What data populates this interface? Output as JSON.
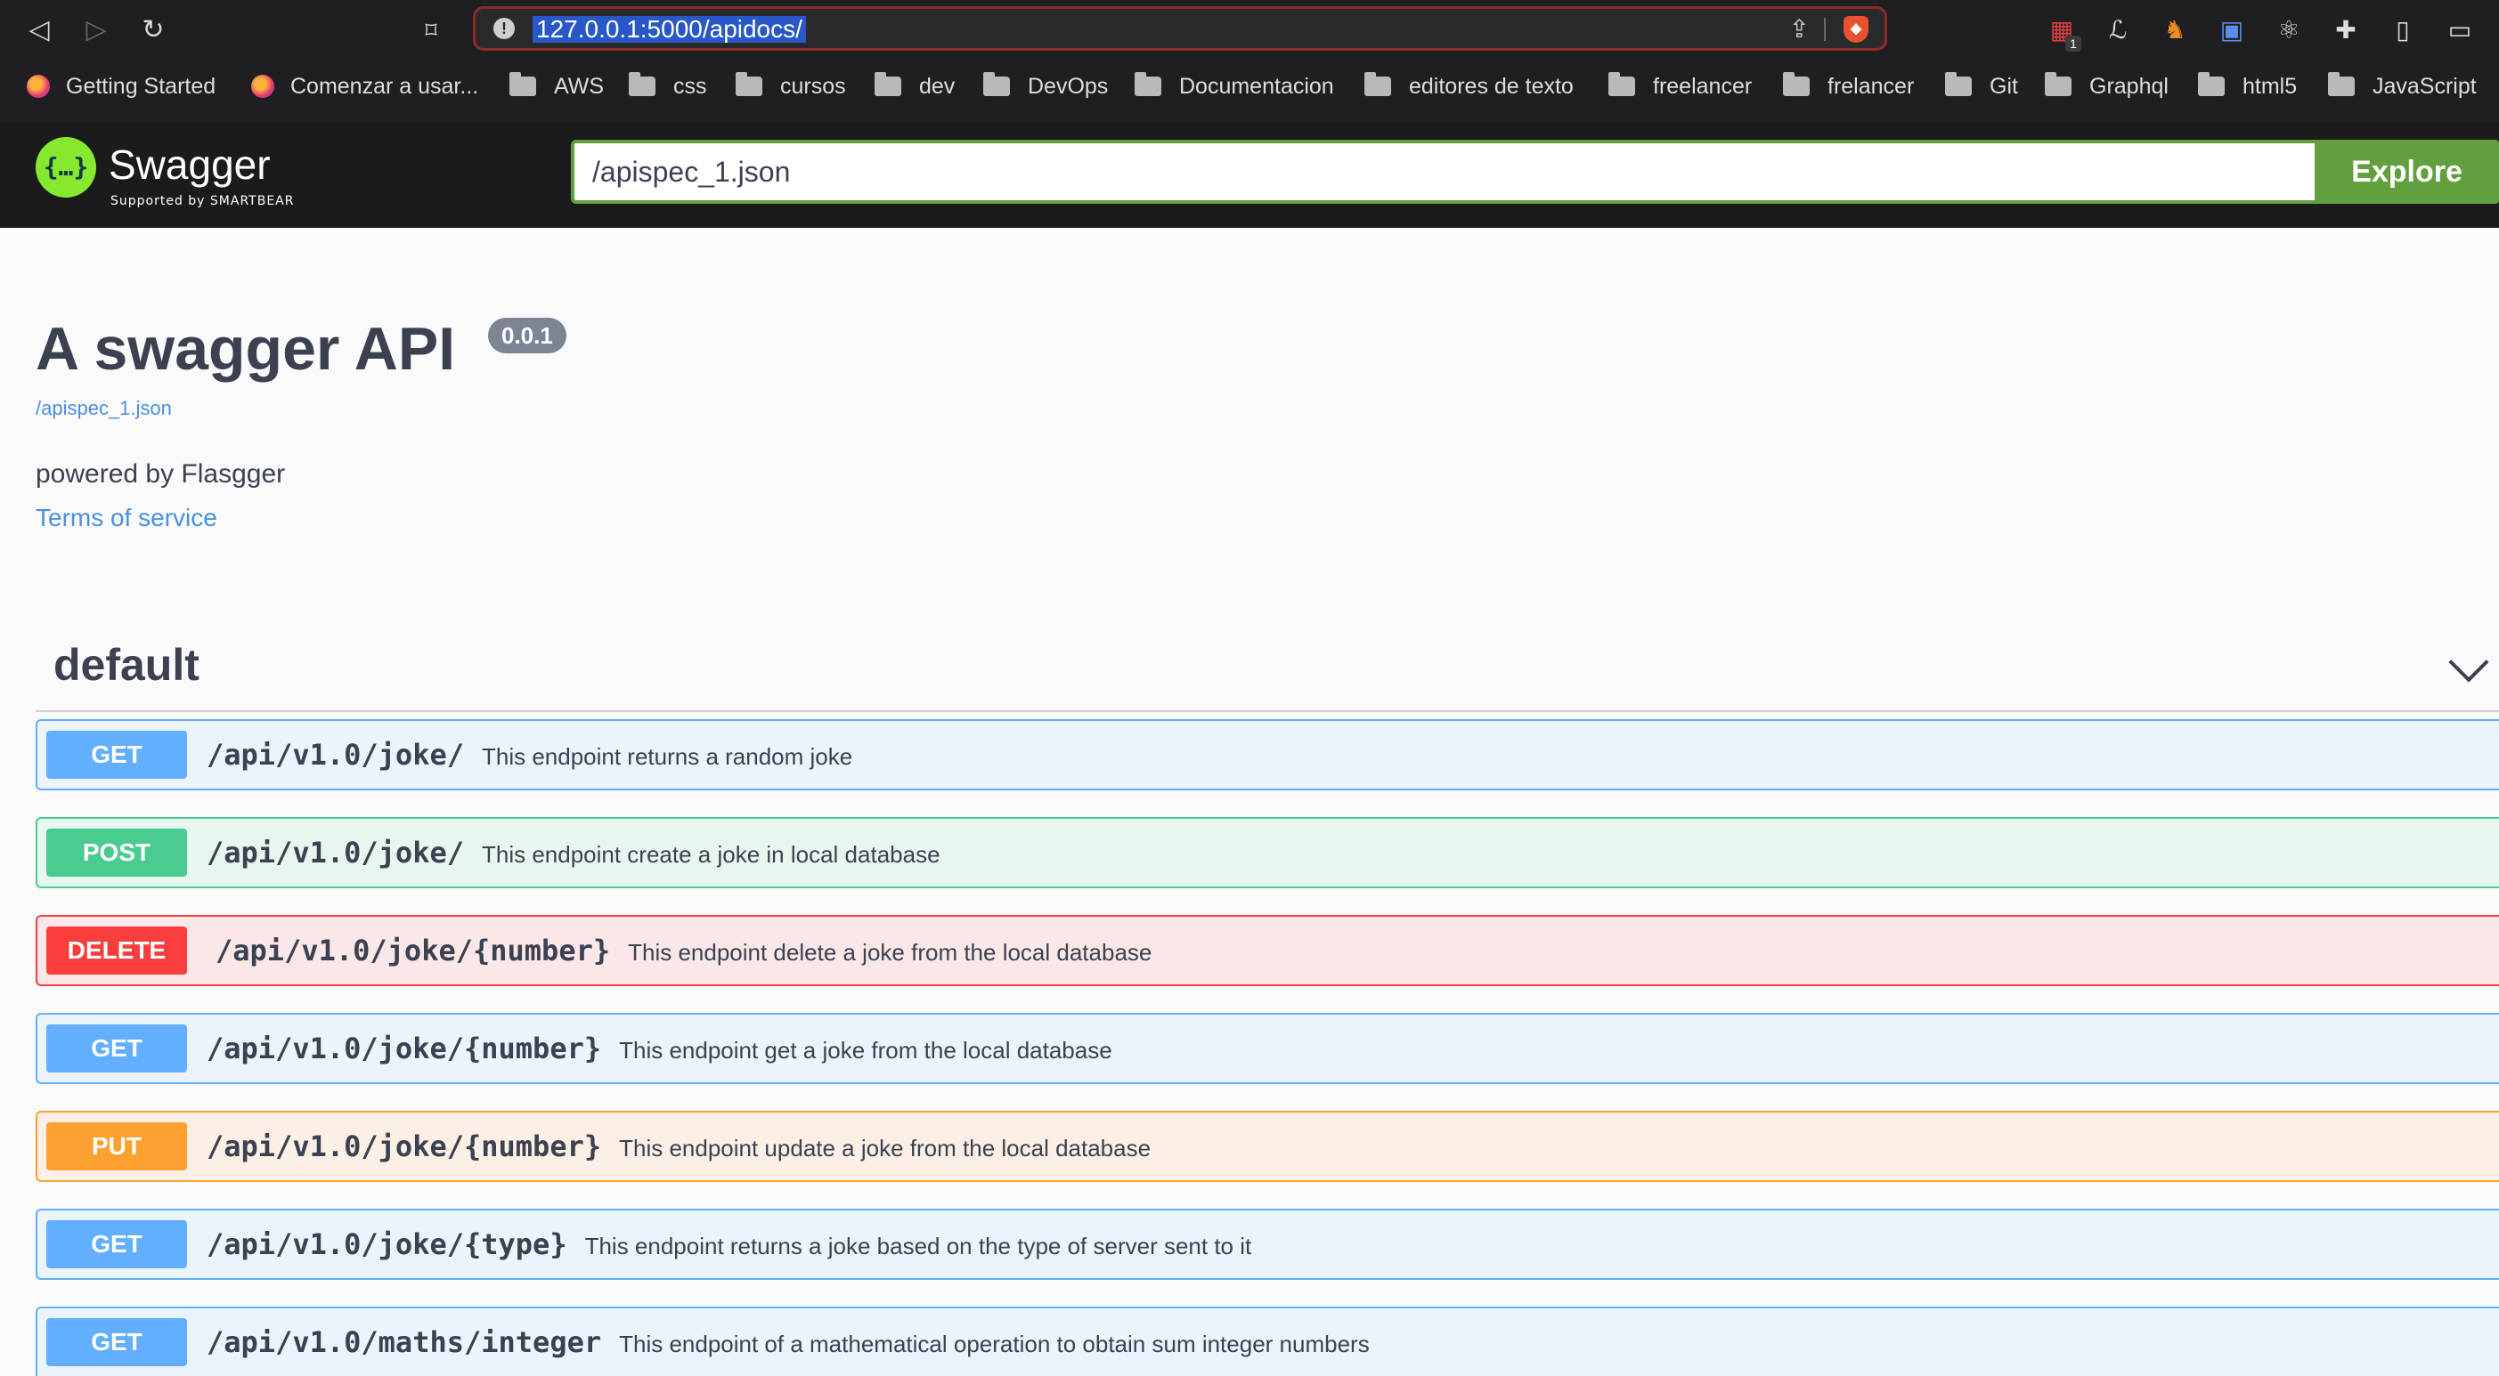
{
  "browser": {
    "url": "127.0.0.1:5000/apidocs/",
    "extension_badge": "1",
    "bookmarks": [
      {
        "label": "Getting Started",
        "icon": "firefox-icon"
      },
      {
        "label": "Comenzar a usar...",
        "icon": "firefox-icon"
      },
      {
        "label": "AWS",
        "icon": "folder-icon"
      },
      {
        "label": "css",
        "icon": "folder-icon"
      },
      {
        "label": "cursos",
        "icon": "folder-icon"
      },
      {
        "label": "dev",
        "icon": "folder-icon"
      },
      {
        "label": "DevOps",
        "icon": "folder-icon"
      },
      {
        "label": "Documentacion",
        "icon": "folder-icon"
      },
      {
        "label": "editores de texto",
        "icon": "folder-icon"
      },
      {
        "label": "freelancer",
        "icon": "folder-icon"
      },
      {
        "label": "frelancer",
        "icon": "folder-icon"
      },
      {
        "label": "Git",
        "icon": "folder-icon"
      },
      {
        "label": "Graphql",
        "icon": "folder-icon"
      },
      {
        "label": "html5",
        "icon": "folder-icon"
      },
      {
        "label": "JavaScript",
        "icon": "folder-icon"
      }
    ]
  },
  "topbar": {
    "logo_text": "Swagger",
    "logo_sub": "Supported by SMARTBEAR",
    "spec_url": "/apispec_1.json",
    "explore_label": "Explore"
  },
  "info": {
    "title": "A swagger API",
    "version": "0.0.1",
    "spec_link": "/apispec_1.json",
    "description": "powered by Flasgger",
    "terms_link": "Terms of service"
  },
  "section": {
    "title": "default"
  },
  "operations": [
    {
      "method": "GET",
      "path": "/api/v1.0/joke/",
      "summary": "This endpoint returns a random joke"
    },
    {
      "method": "POST",
      "path": "/api/v1.0/joke/",
      "summary": "This endpoint create a joke in local database"
    },
    {
      "method": "DELETE",
      "path": "/api/v1.0/joke/{number}",
      "summary": "This endpoint delete a joke from the local database"
    },
    {
      "method": "GET",
      "path": "/api/v1.0/joke/{number}",
      "summary": "This endpoint get a joke from the local database"
    },
    {
      "method": "PUT",
      "path": "/api/v1.0/joke/{number}",
      "summary": "This endpoint update a joke from the local database"
    },
    {
      "method": "GET",
      "path": "/api/v1.0/joke/{type}",
      "summary": "This endpoint returns a joke based on the type of server sent to it"
    },
    {
      "method": "GET",
      "path": "/api/v1.0/maths/integer",
      "summary": "This endpoint of a mathematical operation to obtain sum integer numbers"
    }
  ],
  "colors": {
    "get": "#61affe",
    "post": "#49cc90",
    "delete": "#f93e3e",
    "put": "#fca130",
    "explore": "#62a03f",
    "link": "#4990e2"
  }
}
